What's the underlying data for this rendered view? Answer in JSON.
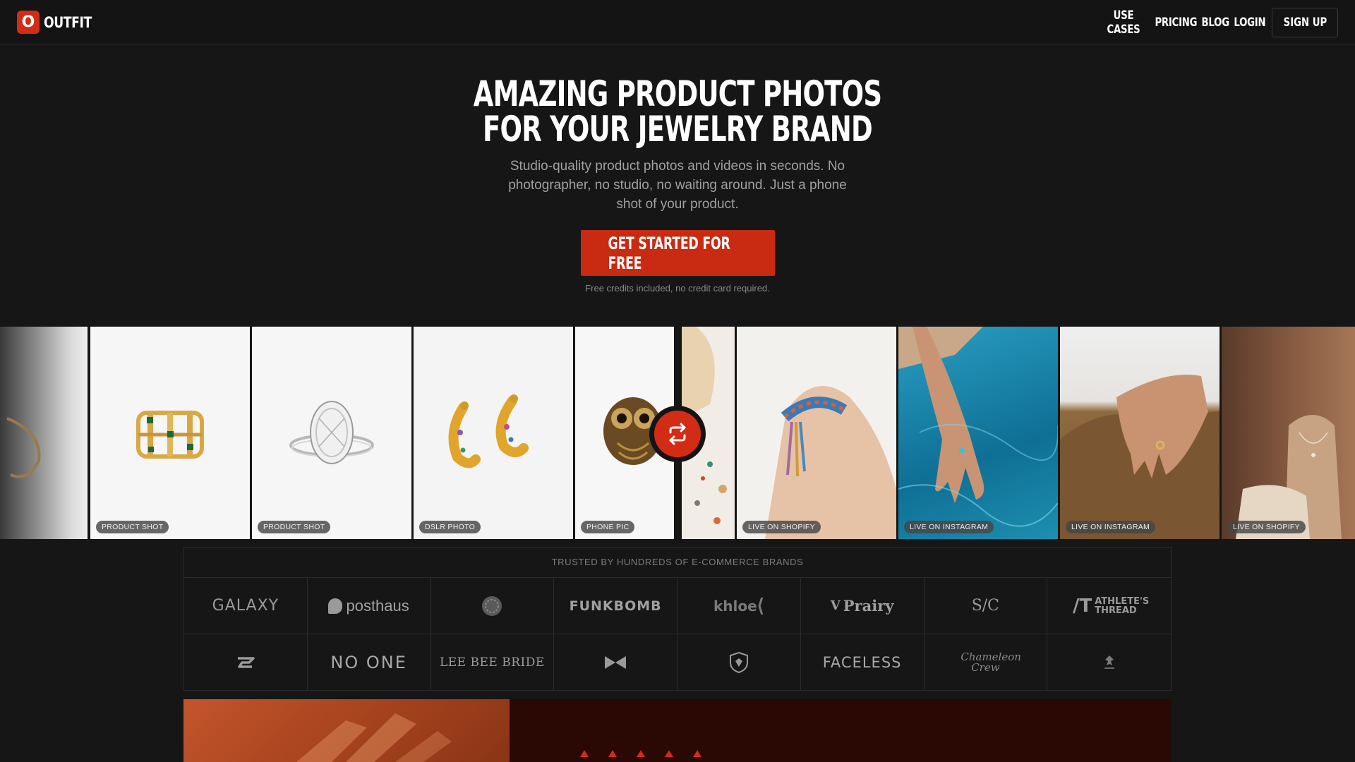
{
  "nav": {
    "logo_mark": "O",
    "logo_text": "OUTFIT",
    "links": [
      "USE CASES",
      "PRICING",
      "BLOG",
      "LOGIN"
    ],
    "signup": "SIGN UP"
  },
  "hero": {
    "title_line1": "AMAZING PRODUCT PHOTOS",
    "title_line2": "FOR YOUR JEWELRY BRAND",
    "subtitle": "Studio-quality product photos and videos in seconds. No photographer, no studio, no waiting around. Just a phone shot of your product.",
    "cta": "GET STARTED FOR FREE",
    "cta_note": "Free credits included, no credit card required."
  },
  "strip": {
    "cards": [
      {
        "badge": "PRODUCT SHOT",
        "subject": "gold-cage-ring"
      },
      {
        "badge": "PRODUCT SHOT",
        "subject": "diamond-ring"
      },
      {
        "badge": "DSLR PHOTO",
        "subject": "gold-hoop-earrings"
      },
      {
        "badge": "PHONE PIC",
        "subject": "owl-ring"
      },
      {
        "badge": "LIVE ON SHOPIFY",
        "subject": "woven-bracelet"
      },
      {
        "badge": "LIVE ON INSTAGRAM",
        "subject": "hand-in-pool"
      },
      {
        "badge": "LIVE ON INSTAGRAM",
        "subject": "hand-on-rock"
      },
      {
        "badge": "LIVE ON SHOPIFY",
        "subject": "necklace-on-stone"
      }
    ]
  },
  "trusted": {
    "heading": "TRUSTED BY HUNDREDS OF E-COMMERCE BRANDS",
    "logos": [
      {
        "text": "GALAXY",
        "name": "galaxy-logo"
      },
      {
        "text": "posthaus",
        "name": "posthaus-logo"
      },
      {
        "text": "",
        "name": "round-emblem-logo"
      },
      {
        "text": "FUNKBOMB",
        "name": "funkbomb-logo"
      },
      {
        "text": "khloe",
        "name": "khloe-logo"
      },
      {
        "text": "Prairy",
        "name": "prairy-logo"
      },
      {
        "text": "S/C",
        "name": "sc-logo"
      },
      {
        "text": "ATHLETE'S THREAD",
        "name": "athletes-thread-logo"
      },
      {
        "text": "",
        "name": "swoosh-logo"
      },
      {
        "text": "NO ONE",
        "name": "no-one-logo"
      },
      {
        "text": "LEE BEE BRIDE",
        "name": "lee-bee-bride-logo"
      },
      {
        "text": "",
        "name": "bowtie-logo"
      },
      {
        "text": "",
        "name": "shield-crest-logo"
      },
      {
        "text": "FACELESS",
        "name": "faceless-logo"
      },
      {
        "text": "Chameleon Crew",
        "name": "chameleon-crew-logo"
      },
      {
        "text": "",
        "name": "crest-small-logo"
      }
    ]
  },
  "colors": {
    "accent": "#d32c14",
    "background": "#161616"
  }
}
